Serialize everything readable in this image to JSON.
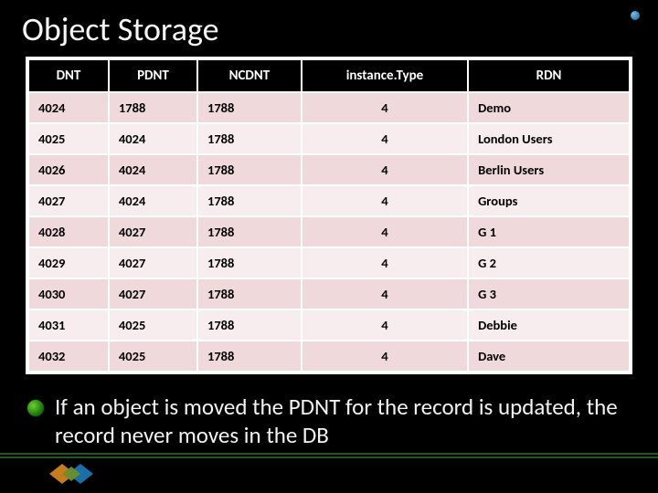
{
  "title": "Object Storage",
  "table": {
    "headers": [
      "DNT",
      "PDNT",
      "NCDNT",
      "instance.Type",
      "RDN"
    ],
    "rows": [
      [
        "4024",
        "1788",
        "1788",
        "4",
        "Demo"
      ],
      [
        "4025",
        "4024",
        "1788",
        "4",
        "London Users"
      ],
      [
        "4026",
        "4024",
        "1788",
        "4",
        "Berlin Users"
      ],
      [
        "4027",
        "4024",
        "1788",
        "4",
        "Groups"
      ],
      [
        "4028",
        "4027",
        "1788",
        "4",
        "G 1"
      ],
      [
        "4029",
        "4027",
        "1788",
        "4",
        "G 2"
      ],
      [
        "4030",
        "4027",
        "1788",
        "4",
        "G 3"
      ],
      [
        "4031",
        "4025",
        "1788",
        "4",
        "Debbie"
      ],
      [
        "4032",
        "4025",
        "1788",
        "4",
        "Dave"
      ]
    ]
  },
  "bullet": "If an object is moved the PDNT for the record is updated, the record never moves in the DB"
}
